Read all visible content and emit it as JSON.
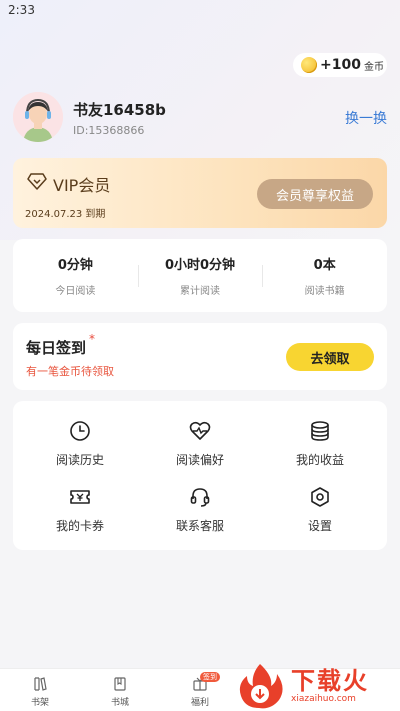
{
  "status_bar": {
    "time": "2:33"
  },
  "coins": {
    "amount": "+100",
    "unit": "金币"
  },
  "profile": {
    "username": "书友16458b",
    "user_id": "ID:15368866",
    "switch_label": "换一换"
  },
  "vip": {
    "title": "VIP会员",
    "expire": "2024.07.23 到期",
    "button": "会员尊享权益"
  },
  "stats": [
    {
      "value": "0分钟",
      "label": "今日阅读"
    },
    {
      "value": "0小时0分钟",
      "label": "累计阅读"
    },
    {
      "value": "0本",
      "label": "阅读书籍"
    }
  ],
  "checkin": {
    "title": "每日签到",
    "dot": "*",
    "subtitle": "有一笔金币待领取",
    "button": "去领取"
  },
  "menu": [
    {
      "label": "阅读历史",
      "icon": "clock-icon"
    },
    {
      "label": "阅读偏好",
      "icon": "heart-pulse-icon"
    },
    {
      "label": "我的收益",
      "icon": "coins-stack-icon"
    },
    {
      "label": "我的卡券",
      "icon": "ticket-icon"
    },
    {
      "label": "联系客服",
      "icon": "headset-icon"
    },
    {
      "label": "设置",
      "icon": "settings-icon"
    }
  ],
  "tabs": [
    {
      "label": "书架",
      "icon": "bookshelf-icon"
    },
    {
      "label": "书城",
      "icon": "book-icon"
    },
    {
      "label": "福利",
      "icon": "gift-icon",
      "badge": "签到"
    }
  ],
  "watermark": {
    "main": "下载火",
    "sub": "xiazaihuo.com"
  },
  "colors": {
    "accent_blue": "#3a7bd5",
    "checkin_yellow": "#f8d531",
    "vip_gold": "#c7a786",
    "alert_red": "#e8553e"
  }
}
